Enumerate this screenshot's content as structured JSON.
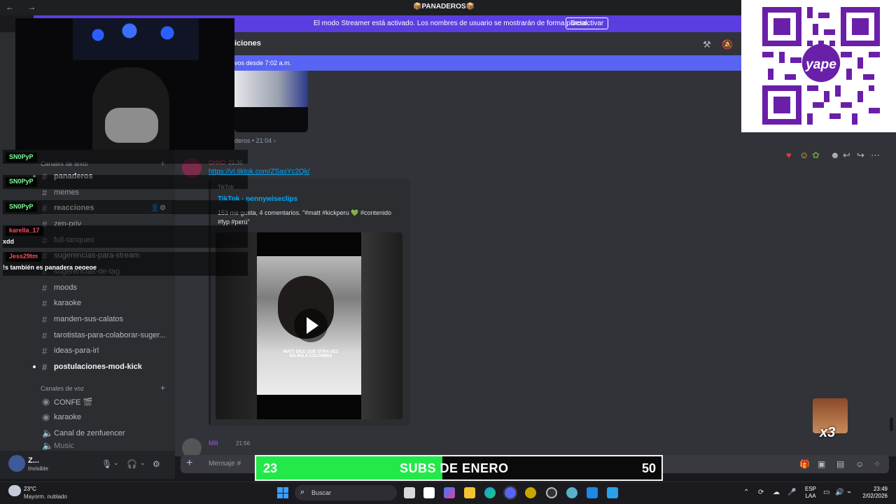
{
  "window": {
    "title": "📦PANADEROS📦",
    "nav": "← →"
  },
  "streamer_banner": {
    "message": "El modo Streamer está activado. Los nombres de usuario se mostrarán de forma parcial.",
    "button": "Desactivar"
  },
  "channel": {
    "name_partial": "iciones",
    "new_messages": "vos desde 7:02 a.m."
  },
  "prev_message_footer": "deros • 21:04 ›",
  "sidebar": {
    "text_category": "Canales de texto",
    "voice_category": "Canales de voz",
    "text_channels": [
      {
        "label": "panaderos",
        "bold": true
      },
      {
        "label": "memes",
        "bold": false
      },
      {
        "label": "reacciones",
        "bold": true
      },
      {
        "label": "zen-priv",
        "bold": false
      },
      {
        "label": "full-tanqueo",
        "bold": false
      },
      {
        "label": "sugerencias-para-stream",
        "bold": false
      },
      {
        "label": "sugerencias-de-tag",
        "bold": false
      },
      {
        "label": "moods",
        "bold": false
      },
      {
        "label": "karaoke",
        "bold": false
      },
      {
        "label": "manden-sus-calatos",
        "bold": false
      },
      {
        "label": "tarotistas-para-colaborar-suger...",
        "bold": false
      },
      {
        "label": "ideas-para-irl",
        "bold": false
      },
      {
        "label": "postulaciones-mod-kick",
        "bold": true
      }
    ],
    "voice_channels": [
      {
        "label": "CONFE 🎬"
      },
      {
        "label": "karaoke"
      },
      {
        "label": "Canal de zenfuencer"
      },
      {
        "label": "Music"
      }
    ]
  },
  "user_panel": {
    "name": "Z...",
    "status": "Invisible"
  },
  "message": {
    "author_tag": "OHNO",
    "time": "21:36",
    "link": "https://vt.tiktok.com/ZSasYc2Qk/",
    "embed": {
      "provider": "TikTok",
      "title": "TikTok · pennywiseclips",
      "description": "153 me gusta, 4 comentarios. \"#matt #kickperu 💚 #contenido #fyp #perú\"",
      "video_caption": "MATT DICE QUE OTRA VEZ NO IRÁ A COLOMBIA"
    }
  },
  "message2": {
    "author": "Mili",
    "time": "21:56"
  },
  "composer": {
    "placeholder": "Mensaje #"
  },
  "chat_overlay": {
    "lines": [
      {
        "user": "SN0PyP",
        "color": "green"
      },
      {
        "user": "SN0PyP",
        "color": "green"
      },
      {
        "user": "SN0PyP",
        "color": "green"
      },
      {
        "user": "karella_17",
        "color": "red"
      },
      {
        "text": "xdd"
      },
      {
        "user": "Jess29tm",
        "color": "red"
      },
      {
        "text": "!s también es panadera oeoeoe"
      }
    ]
  },
  "subs_goal": {
    "current": "23",
    "label": "SUBS DE ENERO",
    "goal": "50",
    "progress": 0.46
  },
  "x3_badge": "x3",
  "qr_brand": "yape",
  "taskbar": {
    "weather_temp": "23°C",
    "weather_desc": "Mayorm. nublado",
    "search": "Buscar",
    "lang_1": "ESP",
    "lang_2": "LAA",
    "time": "23:49",
    "date": "2/02/2026"
  },
  "colors": {
    "streamer_banner": "#5c3ee0",
    "accent": "#5865f2",
    "subs_fill": "#22e84a",
    "qr_purple": "#6a1fa8"
  }
}
